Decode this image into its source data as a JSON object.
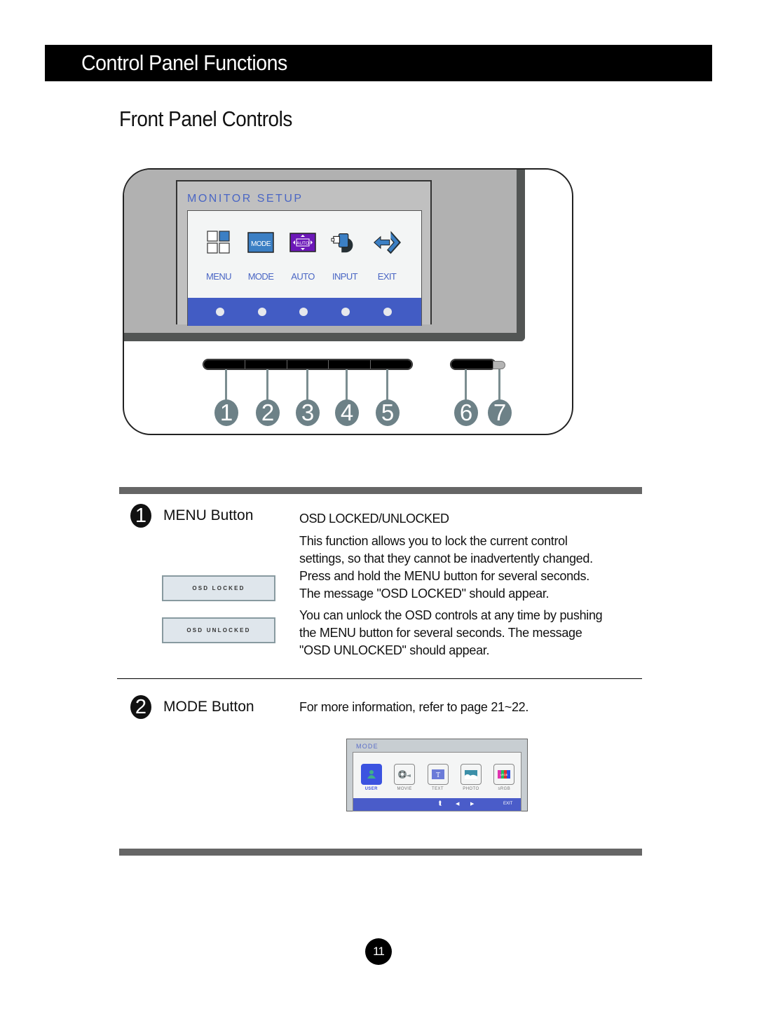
{
  "header": {
    "title": "Control Panel Functions"
  },
  "section": {
    "title": "Front Panel Controls"
  },
  "monitor_osd": {
    "title": "MONITOR SETUP",
    "items": [
      {
        "label": "MENU",
        "icon": "menu-grid-icon"
      },
      {
        "label": "MODE",
        "icon": "mode-icon",
        "icon_text": "MODE"
      },
      {
        "label": "AUTO",
        "icon": "auto-icon",
        "icon_text": "AUTO"
      },
      {
        "label": "INPUT",
        "icon": "input-connector-icon"
      },
      {
        "label": "EXIT",
        "icon": "exit-arrow-icon"
      }
    ],
    "colors": {
      "accent": "#4a66c4",
      "bar": "#425cc4",
      "auto_icon": "#6c18b8",
      "mode_icon": "#3b7fc4"
    }
  },
  "front_buttons": {
    "numbers": [
      "1",
      "2",
      "3",
      "4",
      "5",
      "6",
      "7"
    ]
  },
  "buttons": [
    {
      "number": "1",
      "label": "MENU Button",
      "heading": "OSD LOCKED/UNLOCKED",
      "paragraphs": [
        "This function allows you to lock the current control settings, so that they cannot be inadvertently changed. Press and hold the MENU button  for several seconds. The message \"OSD LOCKED\"  should appear.",
        "You can unlock the OSD controls at any time by pushing the MENU button  for several seconds. The message \"OSD UNLOCKED\"  should appear."
      ],
      "lines1": [
        "This function allows you to lock the current control",
        "settings, so that they cannot be inadvertently changed.",
        "Press and hold the MENU button  for several seconds.",
        "The message \"OSD LOCKED\"  should appear."
      ],
      "lines2": [
        "You can unlock the OSD controls at any time by pushing",
        "the MENU button  for several seconds. The message",
        "\"OSD UNLOCKED\"  should appear."
      ],
      "messages": [
        "OSD LOCKED",
        "OSD UNLOCKED"
      ]
    },
    {
      "number": "2",
      "label": "MODE Button",
      "text": "For more information, refer to page 21~22."
    }
  ],
  "mode_osd": {
    "title": "MODE",
    "items": [
      {
        "label": "USER",
        "icon": "user-icon",
        "active": true
      },
      {
        "label": "MOVIE",
        "icon": "movie-reel-icon",
        "active": false
      },
      {
        "label": "TEXT",
        "icon": "text-icon",
        "icon_text": "T",
        "active": false
      },
      {
        "label": "PHOTO",
        "icon": "photo-icon",
        "active": false
      },
      {
        "label": "sRGB",
        "icon": "srgb-icon",
        "icon_text": "sRGB",
        "active": false
      }
    ],
    "bar_exit": "EXIT"
  },
  "page_number": "11"
}
